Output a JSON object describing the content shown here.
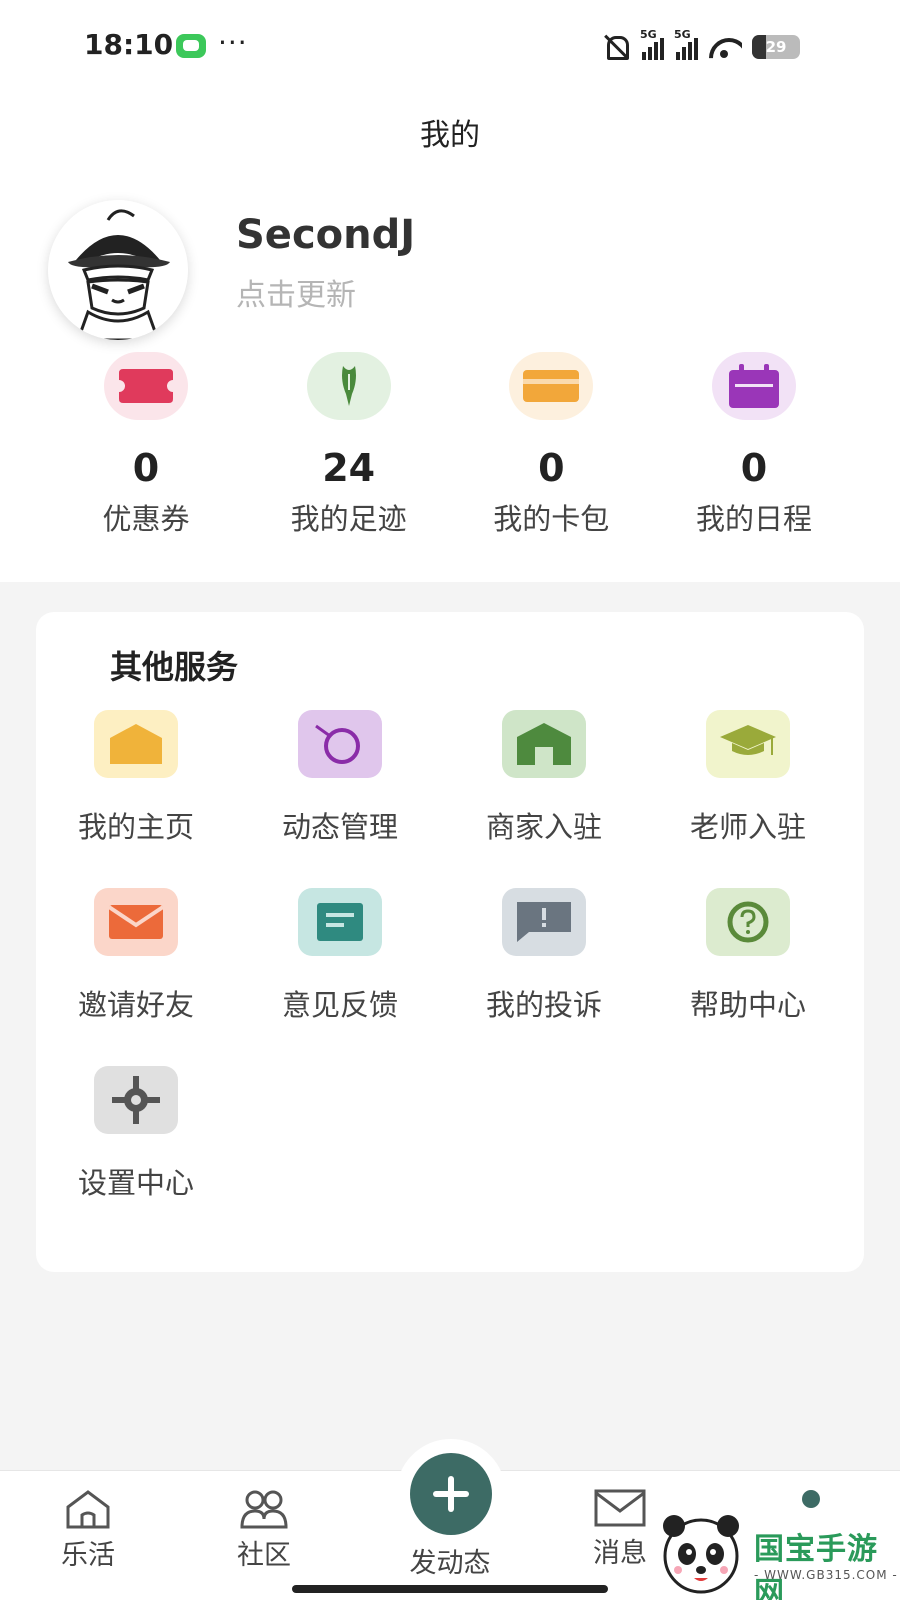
{
  "status_bar": {
    "time": "18:10",
    "more": "···",
    "signal_label_1": "5G",
    "signal_label_2": "5G",
    "battery": "29"
  },
  "header": {
    "title": "我的"
  },
  "profile": {
    "username": "SecondJ",
    "hint": "点击更新"
  },
  "stats": [
    {
      "value": "0",
      "label": "优惠券",
      "icon": "coupon-icon",
      "color": "#e03a5c",
      "bg": "#fbe5ea"
    },
    {
      "value": "24",
      "label": "我的足迹",
      "icon": "footprint-icon",
      "color": "#4a8a3c",
      "bg": "#e3f1e1"
    },
    {
      "value": "0",
      "label": "我的卡包",
      "icon": "card-wallet-icon",
      "color": "#f2a73a",
      "bg": "#fdf0de"
    },
    {
      "value": "0",
      "label": "我的日程",
      "icon": "calendar-icon",
      "color": "#9a36b8",
      "bg": "#f2e2f6"
    }
  ],
  "services": {
    "title": "其他服务",
    "items": [
      {
        "label": "我的主页",
        "icon": "home-icon",
        "color": "#f0b33a",
        "bg": "#fdefc2"
      },
      {
        "label": "动态管理",
        "icon": "moments-icon",
        "color": "#8a2ca8",
        "bg": "#e0c6ec"
      },
      {
        "label": "商家入驻",
        "icon": "shop-icon",
        "color": "#4e8a3e",
        "bg": "#cfe5c8"
      },
      {
        "label": "老师入驻",
        "icon": "graduation-cap-icon",
        "color": "#9aaa3a",
        "bg": "#f1f4cc"
      },
      {
        "label": "邀请好友",
        "icon": "mail-icon",
        "color": "#ec6a3a",
        "bg": "#fbd6c9"
      },
      {
        "label": "意见反馈",
        "icon": "feedback-icon",
        "color": "#2f8a80",
        "bg": "#c6e6e2"
      },
      {
        "label": "我的投诉",
        "icon": "complaint-icon",
        "color": "#6a7580",
        "bg": "#d7dde2"
      },
      {
        "label": "帮助中心",
        "icon": "help-icon",
        "color": "#5a8a3a",
        "bg": "#dcebcf"
      },
      {
        "label": "设置中心",
        "icon": "settings-icon",
        "color": "#555555",
        "bg": "#e0e0e0"
      }
    ]
  },
  "bottom_nav": {
    "items": [
      {
        "label": "乐活",
        "icon": "home-outline-icon"
      },
      {
        "label": "社区",
        "icon": "community-icon"
      },
      {
        "label": "发动态",
        "icon": "plus-icon"
      },
      {
        "label": "消息",
        "icon": "message-icon"
      }
    ],
    "accent": "#3d6b65"
  },
  "watermark": {
    "text": "国宝手游网",
    "url": "- WWW.GB315.COM -"
  }
}
